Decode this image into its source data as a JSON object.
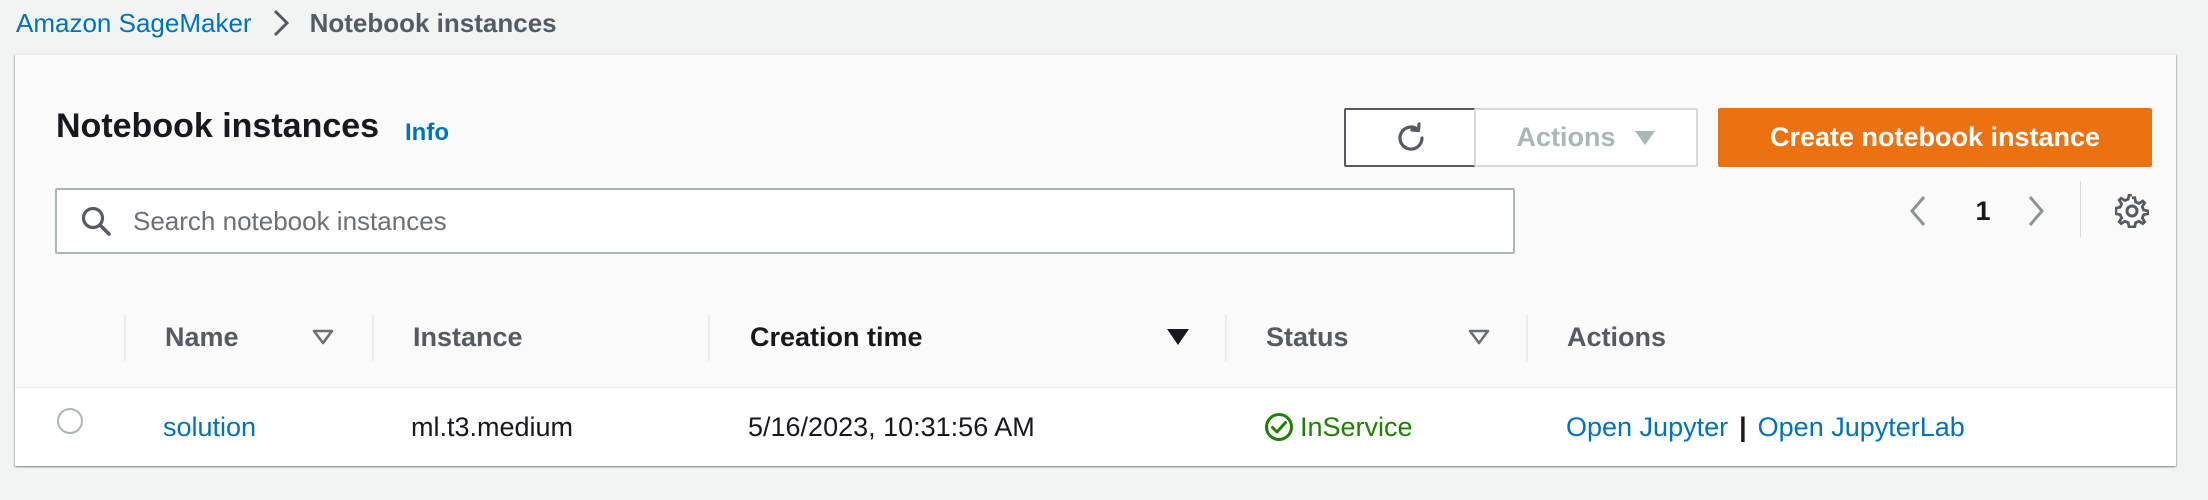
{
  "breadcrumb": {
    "root": "Amazon SageMaker",
    "current": "Notebook instances"
  },
  "header": {
    "title": "Notebook instances",
    "info": "Info",
    "actions_label": "Actions",
    "create_label": "Create notebook instance"
  },
  "search": {
    "placeholder": "Search notebook instances",
    "value": ""
  },
  "pagination": {
    "current_page": "1"
  },
  "table": {
    "columns": {
      "name": "Name",
      "instance": "Instance",
      "creation_time": "Creation time",
      "status": "Status",
      "actions": "Actions"
    },
    "rows": [
      {
        "name": "solution",
        "instance": "ml.t3.medium",
        "creation_time": "5/16/2023, 10:31:56 AM",
        "status": "InService",
        "action_jupyter": "Open Jupyter",
        "separator": "|",
        "action_jupyterlab": "Open JupyterLab"
      }
    ]
  },
  "colors": {
    "link": "#0073bb",
    "primary_button": "#ec7211",
    "status_success": "#1d8102",
    "disabled_text": "#aab7b8"
  },
  "icons": {
    "breadcrumb_separator": "chevron-right-icon",
    "refresh": "refresh-icon",
    "actions_dropdown": "caret-down-icon",
    "search": "search-icon",
    "pager_prev": "chevron-left-icon",
    "pager_next": "chevron-right-icon",
    "settings": "gear-icon",
    "status": "check-circle-icon"
  }
}
